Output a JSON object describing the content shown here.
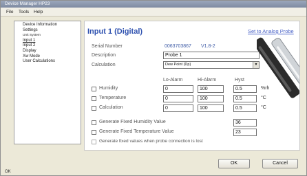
{
  "window": {
    "title": "Device Manager HP23"
  },
  "menubar": {
    "items": [
      "File",
      "Tools",
      "Help"
    ]
  },
  "sidebar": {
    "items": [
      {
        "label": "Device Information",
        "small": false,
        "selected": false
      },
      {
        "label": "Settings",
        "small": false,
        "selected": false
      },
      {
        "label": "Unit System",
        "small": true,
        "selected": false
      },
      {
        "label": "Input 1",
        "small": false,
        "selected": true
      },
      {
        "label": "Input 2",
        "small": false,
        "selected": false
      },
      {
        "label": "Display",
        "small": false,
        "selected": false
      },
      {
        "label": "Xw Mode",
        "small": false,
        "selected": false
      },
      {
        "label": "User Calculations",
        "small": false,
        "selected": false
      }
    ]
  },
  "panel": {
    "title": "Input 1 (Digital)",
    "link": "Set to Analog Probe",
    "serial_label": "Serial Number",
    "serial_value": "0063703867",
    "version_value": "V1.8-2",
    "description_label": "Description",
    "description_value": "Probe 1",
    "calculation_label": "Calculation",
    "calculation_value": "Dew Point (Dp)",
    "columns": {
      "lo": "Lo-Alarm",
      "hi": "Hi-Alarm",
      "hyst": "Hyst"
    },
    "rows": [
      {
        "label": "Humidity",
        "lo": "0",
        "hi": "100",
        "hyst": "0.5",
        "unit": "%rh"
      },
      {
        "label": "Temperature",
        "lo": "0",
        "hi": "100",
        "hyst": "0.5",
        "unit": "°C"
      },
      {
        "label": "Calculation",
        "lo": "0",
        "hi": "100",
        "hyst": "0.5",
        "unit": "°C"
      }
    ],
    "fixed_humidity_label": "Generate Fixed Humidity Value",
    "fixed_humidity_value": "36",
    "fixed_temp_label": "Generate Fixed Temperature Value",
    "fixed_temp_value": "23",
    "fixed_lost_label": "Generate fixed values when probe connection is lost"
  },
  "buttons": {
    "ok": "OK",
    "cancel": "Cancel"
  },
  "status": {
    "text": "OK"
  },
  "colors": {
    "title_blue": "#2f52b0",
    "link_blue": "#4a63c8",
    "window_bg": "#ece9d8"
  }
}
